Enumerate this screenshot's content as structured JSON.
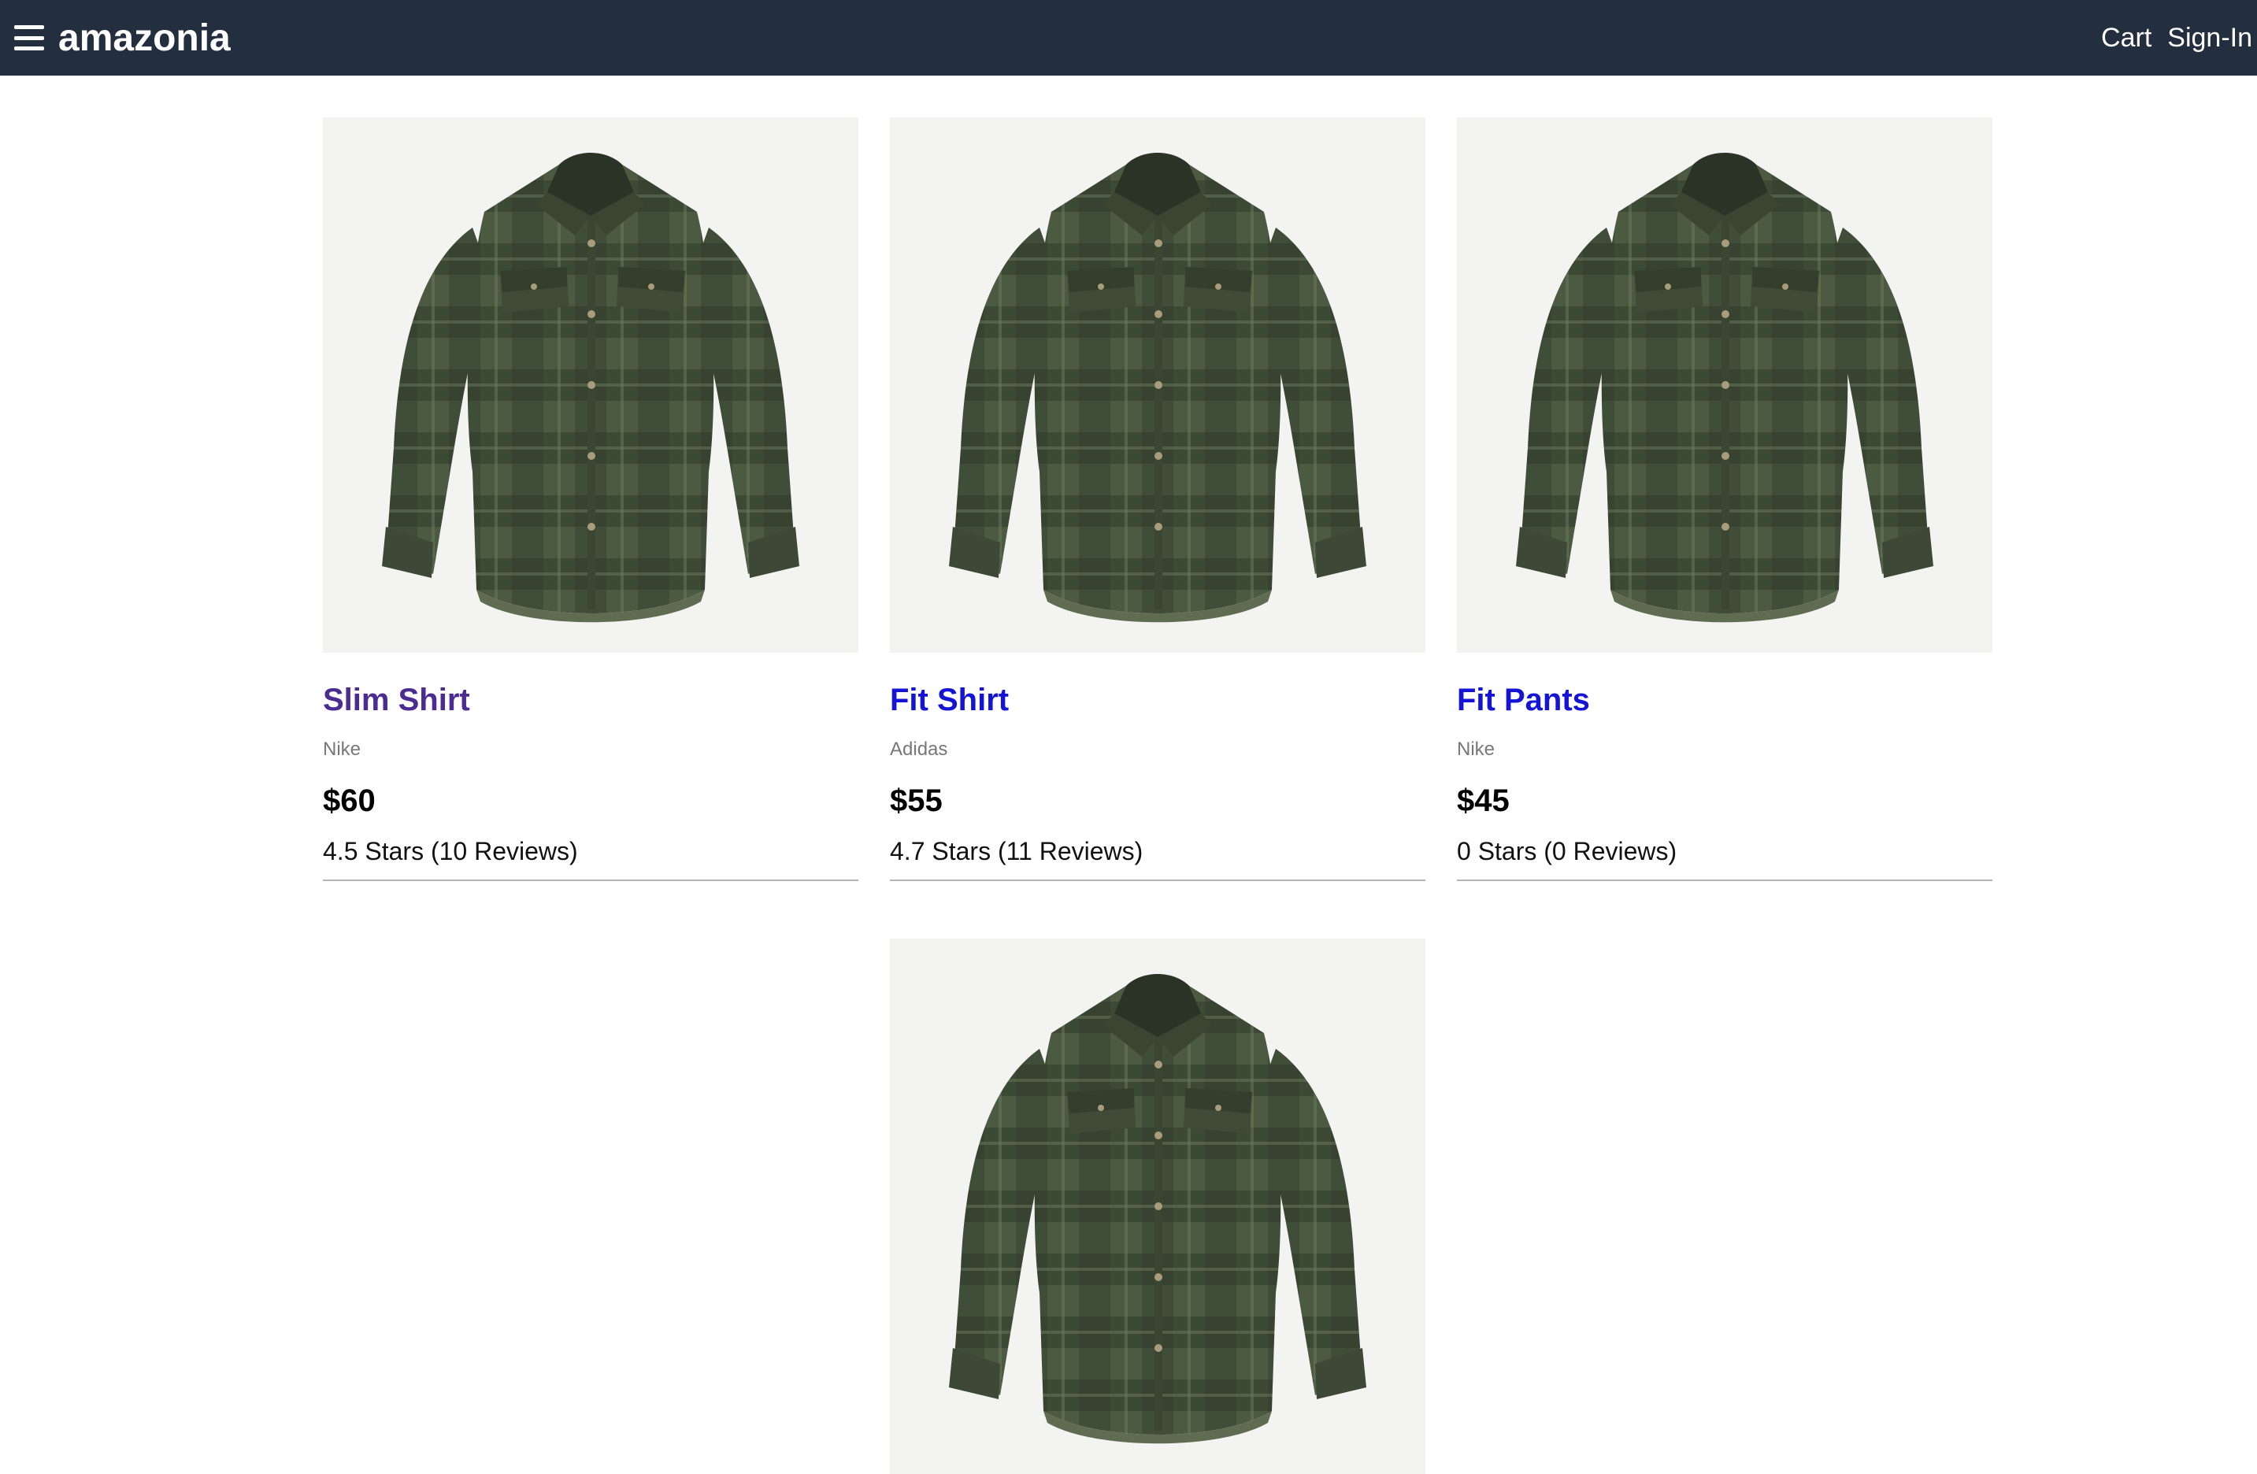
{
  "header": {
    "brand": "amazonia",
    "menu_icon": "hamburger-menu-icon",
    "cart_label": "Cart",
    "signin_label": "Sign-In",
    "background": "#232f3e"
  },
  "products": [
    {
      "name": "Slim Shirt",
      "brand": "Nike",
      "price": "$60",
      "rating": "4.5 Stars (10 Reviews)",
      "link_color": "#4b2c91",
      "image": "green-plaid-shirt"
    },
    {
      "name": "Fit Shirt",
      "brand": "Adidas",
      "price": "$55",
      "rating": "4.7 Stars (11 Reviews)",
      "link_color": "#1414d6",
      "image": "green-plaid-shirt"
    },
    {
      "name": "Fit Pants",
      "brand": "Nike",
      "price": "$45",
      "rating": "0 Stars (0 Reviews)",
      "link_color": "#1414d6",
      "image": "green-plaid-shirt"
    },
    {
      "image": "green-plaid-shirt"
    }
  ]
}
